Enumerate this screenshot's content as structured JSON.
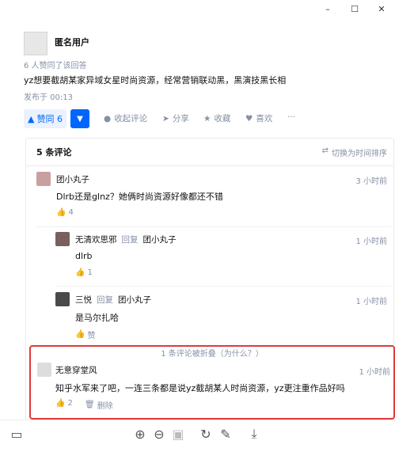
{
  "window": {
    "minimize": "–",
    "maximize": "☐",
    "close": "✕"
  },
  "answer": {
    "author": "匿名用户",
    "likes_text": "6 人赞同了该回答",
    "body": "yz想要截胡某家异域女星时尚资源，经常营销联动黑，黑演技黑长相",
    "posted": "发布于 00:13",
    "vote_label": "赞同 6",
    "actions": {
      "comment": "收起评论",
      "share": "分享",
      "collect": "收藏",
      "like": "喜欢",
      "more": "···"
    }
  },
  "comments": {
    "count_label": "5 条评论",
    "sort_label": "切换为时间排序",
    "items": [
      {
        "author": "团小丸子",
        "time": "3 小时前",
        "text": "Dlrb还是glnz？她俩时尚资源好像都还不错",
        "likes": "4"
      },
      {
        "author": "无清欢思邪",
        "reply_word": "回复",
        "reply_to": "团小丸子",
        "time": "1 小时前",
        "text": "dlrb",
        "likes": "1"
      },
      {
        "author": "三悦",
        "reply_word": "回复",
        "reply_to": "团小丸子",
        "time": "1 小时前",
        "text": "是马尔扎哈",
        "likes": "赞"
      }
    ],
    "folded_label": "1 条评论被折叠（为什么？）",
    "folded": {
      "author": "无意穿堂风",
      "time": "1 小时前",
      "text": "知乎水军来了吧，一连三条都是说yz截胡某人时尚资源，yz更注重作品好吗",
      "likes": "2",
      "delete": "删除"
    }
  },
  "colors": {
    "accent": "#0066ff",
    "highlight_box": "#e03a3a",
    "muted": "#8590a6"
  }
}
